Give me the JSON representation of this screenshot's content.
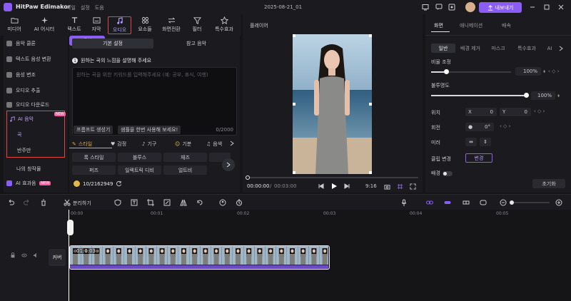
{
  "app": {
    "name": "HitPaw Edimakor",
    "menu": [
      "파일",
      "설정",
      "도움"
    ],
    "document_title": "2025-08-21_01",
    "export_label": "내보내기"
  },
  "tool_tabs": [
    "미디어",
    "AI 어시터",
    "텍스트",
    "자막",
    "오디오",
    "요소들",
    "화면전환",
    "필터",
    "특수효과"
  ],
  "sidebar": {
    "items": [
      "음악 클론",
      "텍스트 음성 변환",
      "음성 변조",
      "오디오 추출",
      "오디오 다운로드"
    ],
    "ai_music": {
      "label": "AI 음악",
      "badge": "NEW",
      "children": [
        "곡",
        "반주만"
      ]
    },
    "my_works": "나의 창작물",
    "ai_effects": {
      "label": "AI 효과음",
      "badge": "NEW"
    }
  },
  "audio_panel": {
    "tabs": [
      "기본 설정",
      "참고 음악"
    ],
    "step_title": "원하는 곡의 느낌을 설명해 주세요",
    "prompt_placeholder": "원하는 곡을 위한 키워드를 입력해주세요 (예: 공부, 휴식, 여행)",
    "char_count": "0/2000",
    "buttons": [
      "프롬프트 생성기",
      "샘플을 한번 사용해 보세요!"
    ],
    "category_tabs": [
      "스타일",
      "감정",
      "기구",
      "기분",
      "음색"
    ],
    "chips": [
      [
        "록 스타일",
        "블루스",
        "재즈"
      ],
      [
        "퍼즈",
        "일렉트릭 디비",
        "얼트비"
      ]
    ],
    "credits": "10/2162949",
    "generate_label": "생성"
  },
  "player": {
    "title": "플레이어",
    "current_time": "00:00:00",
    "total_time": "00:03:00",
    "aspect": "9:16"
  },
  "properties": {
    "tabs": [
      "화면",
      "애니메이션",
      "배속"
    ],
    "sub_tabs": [
      "일반",
      "배경 제거",
      "마스크",
      "특수효과",
      "AI"
    ],
    "scale": {
      "label": "비율 조정",
      "value": "100%",
      "fraction": 1.0
    },
    "opacity": {
      "label": "불투명도",
      "value": "100%",
      "fraction": 1.0
    },
    "position": {
      "label": "위치",
      "x_label": "X",
      "x": "0",
      "y_label": "Y",
      "y": "0"
    },
    "rotate": {
      "label": "회전",
      "value": "0°"
    },
    "flip": {
      "label": "미러"
    },
    "clip_change": {
      "label": "클립 변경",
      "button": "변경"
    },
    "background": {
      "label": "배경"
    },
    "reset_label": "초기화"
  },
  "timeline": {
    "toolbar_split": "분리하기",
    "ruler": [
      "00:00",
      "00:01",
      "00:02",
      "00:03",
      "00:04",
      "00:05"
    ],
    "cover_label": "커버",
    "clip_duration": "01:0:03"
  },
  "colors": {
    "accent": "#8b5cf6",
    "highlight_box": "#e34545",
    "badge": "#ff5aa0"
  }
}
